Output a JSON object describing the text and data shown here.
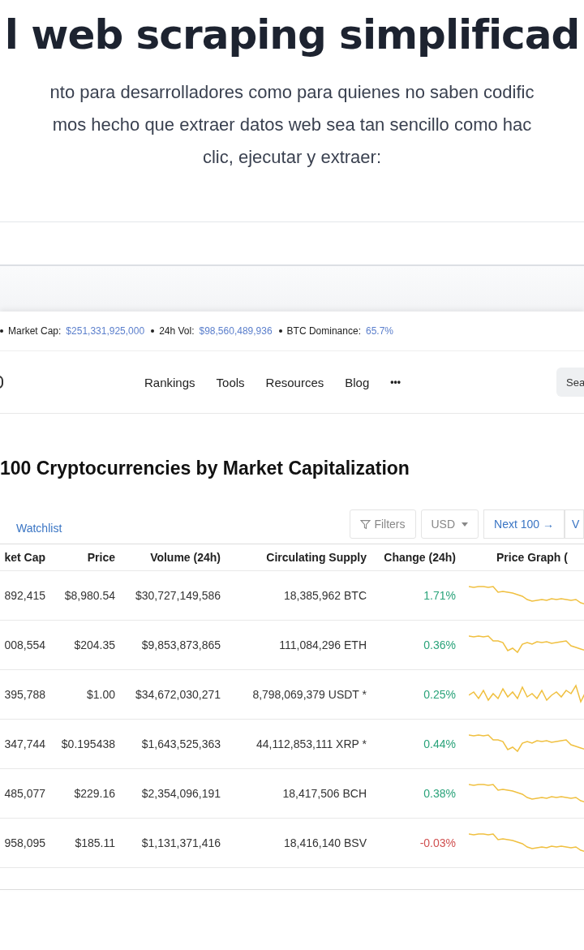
{
  "hero": {
    "heading": "l web scraping simplificad",
    "lines": [
      "nto para desarrolladores como para quienes no saben codific",
      "mos hecho que extraer datos web sea tan sencillo como hac",
      "clic, ejecutar y extraer:"
    ]
  },
  "stats": [
    {
      "label": "Market Cap:",
      "value": "$251,331,925,000"
    },
    {
      "label": "24h Vol:",
      "value": "$98,560,489,936"
    },
    {
      "label": "BTC Dominance:",
      "value": "65.7%"
    }
  ],
  "nav": {
    "items": [
      "Rankings",
      "Tools",
      "Resources",
      "Blog"
    ],
    "more": "•••",
    "search": "Sea"
  },
  "title": "100 Cryptocurrencies by Market Capitalization",
  "watchlist": "Watchlist",
  "controls": {
    "filters": "Filters",
    "currency": "USD",
    "next": "Next 100 →",
    "cut": "V"
  },
  "table": {
    "columns": [
      "ket Cap",
      "Price",
      "Volume (24h)",
      "Circulating Supply",
      "Change (24h)",
      "Price Graph ("
    ],
    "rows": [
      {
        "market_cap": "892,415",
        "price": "$8,980.54",
        "volume": "$30,727,149,586",
        "supply": "18,385,962 BTC",
        "change": "1.71%",
        "color": "#2aa37a"
      },
      {
        "market_cap": "008,554",
        "price": "$204.35",
        "volume": "$9,853,873,865",
        "supply": "111,084,296 ETH",
        "change": "0.36%",
        "color": "#2aa37a"
      },
      {
        "market_cap": "395,788",
        "price": "$1.00",
        "volume": "$34,672,030,271",
        "supply": "8,798,069,379 USDT *",
        "change": "0.25%",
        "color": "#2aa37a"
      },
      {
        "market_cap": "347,744",
        "price": "$0.195438",
        "volume": "$1,643,525,363",
        "supply": "44,112,853,111 XRP *",
        "change": "0.44%",
        "color": "#2aa37a"
      },
      {
        "market_cap": "485,077",
        "price": "$229.16",
        "volume": "$2,354,096,191",
        "supply": "18,417,506 BCH",
        "change": "0.38%",
        "color": "#2aa37a"
      },
      {
        "market_cap": "958,095",
        "price": "$185.11",
        "volume": "$1,131,371,416",
        "supply": "18,416,140 BSV",
        "change": "-0.03%",
        "color": "#d05050"
      }
    ]
  }
}
